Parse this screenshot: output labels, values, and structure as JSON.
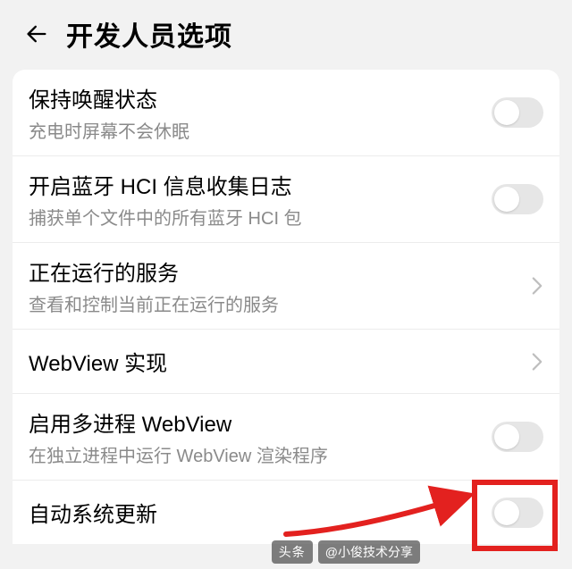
{
  "header": {
    "title": "开发人员选项"
  },
  "items": [
    {
      "title": "保持唤醒状态",
      "subtitle": "充电时屏幕不会休眠",
      "control": "toggle"
    },
    {
      "title": "开启蓝牙 HCI 信息收集日志",
      "subtitle": "捕获单个文件中的所有蓝牙 HCI 包",
      "control": "toggle"
    },
    {
      "title": "正在运行的服务",
      "subtitle": "查看和控制当前正在运行的服务",
      "control": "chevron"
    },
    {
      "title": "WebView 实现",
      "subtitle": "",
      "control": "chevron"
    },
    {
      "title": "启用多进程 WebView",
      "subtitle": "在独立进程中运行 WebView 渲染程序",
      "control": "toggle"
    },
    {
      "title": "自动系统更新",
      "subtitle": "",
      "control": "toggle"
    }
  ],
  "watermark": {
    "badge": "头条",
    "text": "@小俊技术分享"
  }
}
